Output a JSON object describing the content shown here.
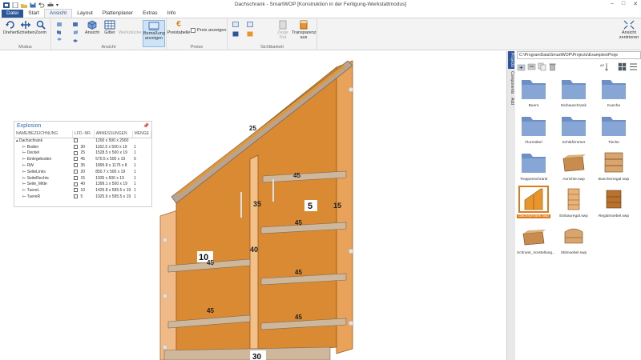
{
  "window": {
    "title": "Dachschrank - SmartWOP [Konstruktion in der Fertigung-Werkstattmodus]",
    "controls": [
      "–",
      "□",
      "✕"
    ]
  },
  "tabs": [
    "Datei",
    "Start",
    "Ansicht",
    "Layout",
    "Plattenplaner",
    "Extras",
    "Info"
  ],
  "active_tab": "Ansicht",
  "ribbon": {
    "modus": {
      "label": "Modus",
      "buttons": [
        "Drehen",
        "Schieben",
        "Zoom"
      ]
    },
    "ansicht": {
      "label": "Ansicht",
      "buttons": [
        "Ansicht",
        "Gitter",
        "Werkstücke",
        "Bemaßung anzeigen"
      ]
    },
    "preise": {
      "label": "Preise",
      "buttons": [
        "Preistabelle"
      ],
      "checkbox": "Preis anzeigen"
    },
    "sichtbarkeit": {
      "label": "Sichtbarkeit",
      "buttons": [
        "Zeige Nut",
        "Transparenz aus"
      ]
    },
    "zentrieren": {
      "label": "Ansicht zentrieren"
    }
  },
  "explosion": {
    "title": "Explosion",
    "columns": [
      "NAME/BEZEICHNUNG",
      "LFD.-NR.",
      "ABMESSUNGEN",
      "MENGE"
    ],
    "root": {
      "name": "Dachschrank",
      "dims": "1200 x 500 x 2000"
    },
    "rows": [
      {
        "name": "Boden",
        "nr": "30",
        "dims": "1162.5 x 500 x 19",
        "qty": "1"
      },
      {
        "name": "Deckel",
        "nr": "25",
        "dims": "1528.5 x 500 x 19",
        "qty": "1"
      },
      {
        "name": "Einlegeboden",
        "nr": "45",
        "dims": "570.5 x 500 x 19",
        "qty": "6"
      },
      {
        "name": "RW",
        "nr": "35",
        "dims": "1895.8 x 1175 x 8",
        "qty": "1"
      },
      {
        "name": "SeiteLinks",
        "nr": "20",
        "dims": "850.7 x 500 x 19",
        "qty": "1"
      },
      {
        "name": "SeiteRechts",
        "nr": "15",
        "dims": "1935 x 500 x 19",
        "qty": "1"
      },
      {
        "name": "Seite_Mitte",
        "nr": "40",
        "dims": "1399.1 x 500 x 19",
        "qty": "1"
      },
      {
        "name": "TuereL",
        "nr": "10",
        "dims": "1426.8 x 595.5 x 19",
        "qty": "1"
      },
      {
        "name": "TuereR",
        "nr": "5",
        "dims": "1925.6 x 595.5 x 19",
        "qty": "1"
      }
    ]
  },
  "model_labels": {
    "deckel": "25",
    "tuere_r": "5",
    "seite_rechts": "15",
    "rw": "35",
    "tuere_l": "10",
    "seite_mitte": "40",
    "boden": "30",
    "einlegeboden": "45"
  },
  "right_panel": {
    "vtabs": [
      "Projects",
      "Components",
      "Add"
    ],
    "path": "C:\\ProgramData\\SmartWOP\\Projects\\Examples\\Proje",
    "items": [
      {
        "name": "Buero",
        "kind": "folder"
      },
      {
        "name": "Einbauschrank",
        "kind": "folder"
      },
      {
        "name": "Kueche",
        "kind": "folder"
      },
      {
        "name": "Flurmöbel",
        "kind": "folder"
      },
      {
        "name": "Schlafzimmer",
        "kind": "folder"
      },
      {
        "name": "Tische",
        "kind": "folder"
      },
      {
        "name": "Treppenschrank",
        "kind": "folder"
      },
      {
        "name": "Anrichte.swp",
        "kind": "file"
      },
      {
        "name": "Buecherregal.swp",
        "kind": "file"
      },
      {
        "name": "Dachschrank.swp",
        "kind": "file",
        "selected": true
      },
      {
        "name": "Einbauregal.swp",
        "kind": "file"
      },
      {
        "name": "Regalmoebel.swp",
        "kind": "file"
      },
      {
        "name": "Schrank_Vorstellung...",
        "kind": "file"
      },
      {
        "name": "Stilmoebel.swp",
        "kind": "file"
      }
    ]
  },
  "colors": {
    "accent": "#2b579a",
    "panel_orange": "#e8952c",
    "folder_blue": "#6d8fc7",
    "selection_orange": "#e07b1a"
  }
}
